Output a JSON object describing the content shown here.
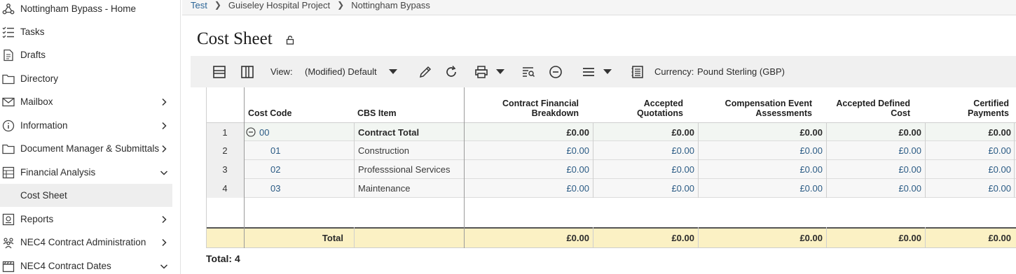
{
  "sidebar": {
    "items": [
      {
        "label": "Nottingham Bypass - Home",
        "icon": "project-network-icon",
        "chevron": "none"
      },
      {
        "label": "Tasks",
        "icon": "tasks-checklist-icon",
        "chevron": "none"
      },
      {
        "label": "Drafts",
        "icon": "drafts-document-icon",
        "chevron": "none"
      },
      {
        "label": "Directory",
        "icon": "folder-icon",
        "chevron": "none"
      },
      {
        "label": "Mailbox",
        "icon": "mail-icon",
        "chevron": "right"
      },
      {
        "label": "Information",
        "icon": "info-icon",
        "chevron": "right"
      },
      {
        "label": "Document Manager & Submittals",
        "icon": "folder-icon",
        "chevron": "right"
      },
      {
        "label": "Financial Analysis",
        "icon": "spreadsheet-icon",
        "chevron": "down"
      },
      {
        "label": "Cost Sheet",
        "icon": "",
        "chevron": "none",
        "active": true
      },
      {
        "label": "Reports",
        "icon": "reports-icon",
        "chevron": "right"
      },
      {
        "label": "NEC4 Contract Administration",
        "icon": "people-group-icon",
        "chevron": "right"
      },
      {
        "label": "NEC4 Contract Dates",
        "icon": "clapper-calendar-icon",
        "chevron": "down"
      }
    ]
  },
  "breadcrumb": {
    "items": [
      "Test",
      "Guiseley Hospital Project",
      "Nottingham Bypass"
    ]
  },
  "page": {
    "title": "Cost Sheet"
  },
  "toolbar": {
    "view_label": "View:",
    "view_value": "(Modified) Default",
    "currency_label": "Currency:",
    "currency_value": "Pound Sterling (GBP)"
  },
  "grid": {
    "headers": {
      "cost_code": "Cost Code",
      "cbs_item": "CBS Item",
      "cfb_line1": "Contract Financial",
      "cfb_line2": "Breakdown",
      "aq_line1": "Accepted",
      "aq_line2": "Quotations",
      "cea_line1": "Compensation Event",
      "cea_line2": "Assessments",
      "adc_line1": "Accepted Defined",
      "adc_line2": "Cost",
      "cp_line1": "Certified",
      "cp_line2": "Payments"
    },
    "rows": [
      {
        "n": "1",
        "code": "00",
        "item": "Contract Total",
        "cfb": "£0.00",
        "aq": "£0.00",
        "cea": "£0.00",
        "adc": "£0.00",
        "cp": "£0.00"
      },
      {
        "n": "2",
        "code": "01",
        "item": "Construction",
        "cfb": "£0.00",
        "aq": "£0.00",
        "cea": "£0.00",
        "adc": "£0.00",
        "cp": "£0.00"
      },
      {
        "n": "3",
        "code": "02",
        "item": "Professsional Services",
        "cfb": "£0.00",
        "aq": "£0.00",
        "cea": "£0.00",
        "adc": "£0.00",
        "cp": "£0.00"
      },
      {
        "n": "4",
        "code": "03",
        "item": "Maintenance",
        "cfb": "£0.00",
        "aq": "£0.00",
        "cea": "£0.00",
        "adc": "£0.00",
        "cp": "£0.00"
      }
    ],
    "summary": {
      "label": "Total",
      "cfb": "£0.00",
      "aq": "£0.00",
      "cea": "£0.00",
      "adc": "£0.00",
      "cp": "£0.00"
    },
    "footer_total": "Total: 4"
  }
}
